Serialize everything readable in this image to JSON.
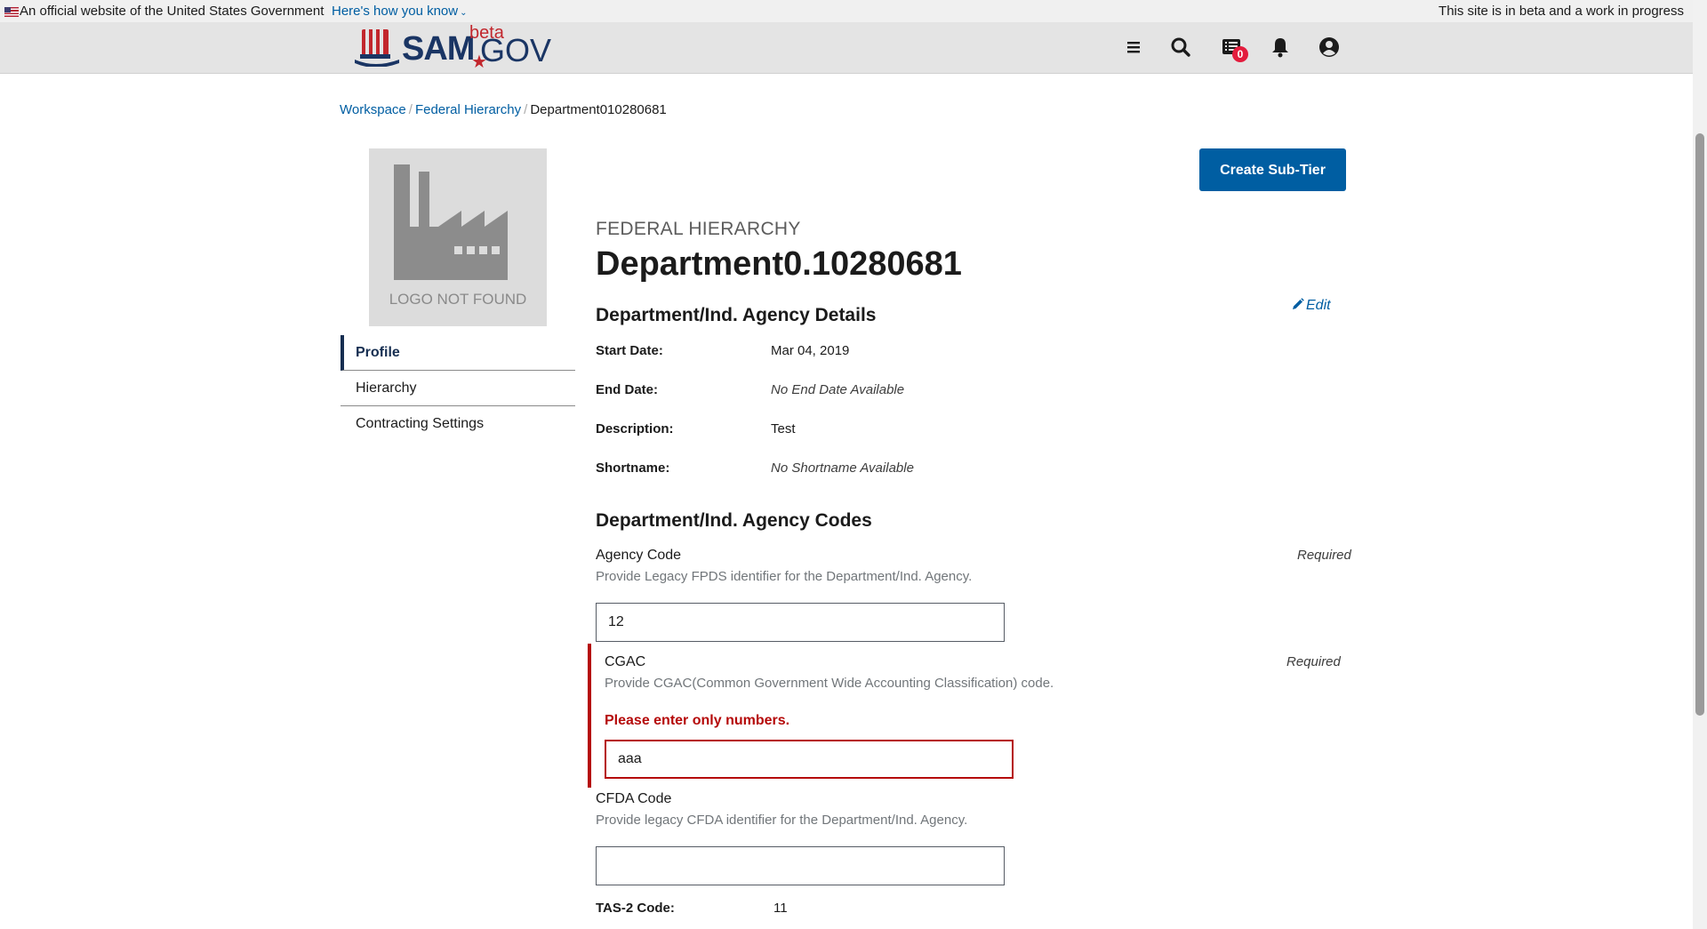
{
  "banner": {
    "official_text": "An official website of the United States Government",
    "how_you_know": "Here's how you know",
    "beta_message": "This site is in beta and a work in progress"
  },
  "header": {
    "logo_sam": "SAM",
    "logo_gov": "GOV",
    "logo_beta": "beta",
    "notification_count": "0",
    "icons": [
      "menu-icon",
      "search-icon",
      "messages-icon",
      "bell-icon",
      "user-account-icon"
    ]
  },
  "breadcrumb": {
    "items": [
      "Workspace",
      "Federal Hierarchy"
    ],
    "current": "Department010280681"
  },
  "logo_box": {
    "text": "LOGO NOT FOUND"
  },
  "sidenav": {
    "items": [
      "Profile",
      "Hierarchy",
      "Contracting Settings"
    ],
    "active": "Profile"
  },
  "actions": {
    "create_sub_tier": "Create Sub-Tier"
  },
  "page": {
    "eyebrow": "FEDERAL HIERARCHY",
    "title": "Department0.10280681"
  },
  "details": {
    "title": "Department/Ind. Agency Details",
    "edit_label": "Edit",
    "start_date_label": "Start Date:",
    "start_date": "Mar 04, 2019",
    "end_date_label": "End Date:",
    "end_date": "No End Date Available",
    "description_label": "Description:",
    "description": "Test",
    "shortname_label": "Shortname:",
    "shortname": "No Shortname Available"
  },
  "codes": {
    "title": "Department/Ind. Agency Codes",
    "required_label": "Required",
    "agency_code": {
      "label": "Agency Code",
      "hint": "Provide Legacy FPDS identifier for the Department/Ind. Agency.",
      "value": "12"
    },
    "cgac": {
      "label": "CGAC",
      "hint": "Provide CGAC(Common Government Wide Accounting Classification) code.",
      "error": "Please enter only numbers.",
      "value": "aaa"
    },
    "cfda": {
      "label": "CFDA Code",
      "hint": "Provide legacy CFDA identifier for the Department/Ind. Agency.",
      "value": ""
    },
    "tas2_label": "TAS-2 Code:",
    "tas2_value": "11"
  },
  "colors": {
    "primary": "#005ea2",
    "error": "#b50909",
    "navy": "#162e51",
    "badge": "#e31c3d"
  }
}
